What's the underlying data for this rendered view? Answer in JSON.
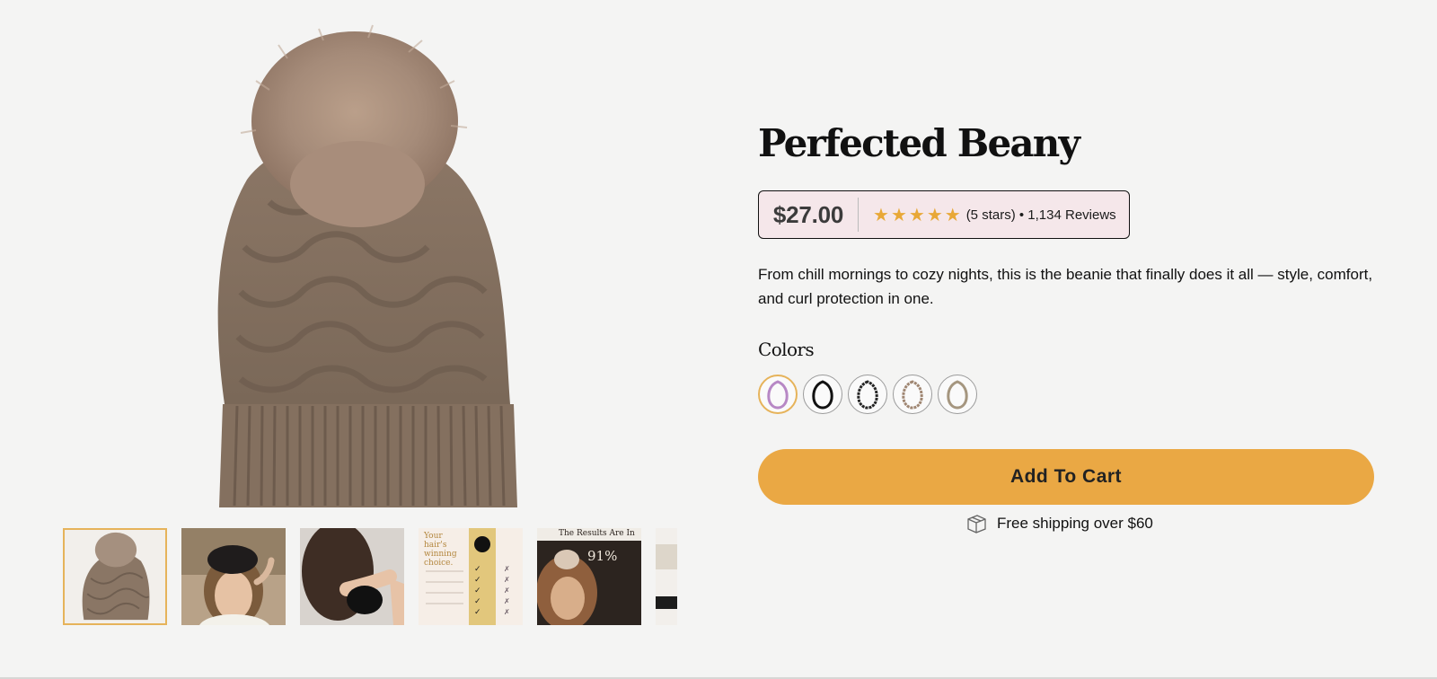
{
  "product": {
    "title": "Perfected Beany",
    "price": "$27.00",
    "rating_stars": 5,
    "rating_text": "(5 stars) • 1,134 Reviews",
    "description": "From chill mornings to cozy nights, this is the beanie that finally does it all — style, comfort, and curl protection in one.",
    "colors_label": "Colors",
    "color_swatches": [
      {
        "name": "pink",
        "color": "#b788c5",
        "selected": true
      },
      {
        "name": "black",
        "color": "#111111",
        "selected": false
      },
      {
        "name": "black-knit",
        "color": "#252525",
        "selected": false
      },
      {
        "name": "tan",
        "color": "#9f8672",
        "selected": false
      },
      {
        "name": "taupe",
        "color": "#a5967f",
        "selected": false
      }
    ],
    "add_to_cart_label": "Add To Cart",
    "shipping_text": "Free shipping over $60"
  },
  "gallery": {
    "thumbnails": [
      {
        "name": "product-front"
      },
      {
        "name": "lifestyle-portrait"
      },
      {
        "name": "hair-scrunchie"
      },
      {
        "name": "comparison-chart",
        "heading": "Your hair's winning choice."
      },
      {
        "name": "results-review",
        "heading": "The Results Are In",
        "stat": "91%"
      },
      {
        "name": "partial-panel"
      }
    ]
  },
  "colors": {
    "background": "#f4f4f3",
    "accent": "#eaa844",
    "price_panel_bg": "#f5e7ea",
    "thumb_active_border": "#e6b35a",
    "star": "#e8a837",
    "beanie": "#8b7766"
  }
}
